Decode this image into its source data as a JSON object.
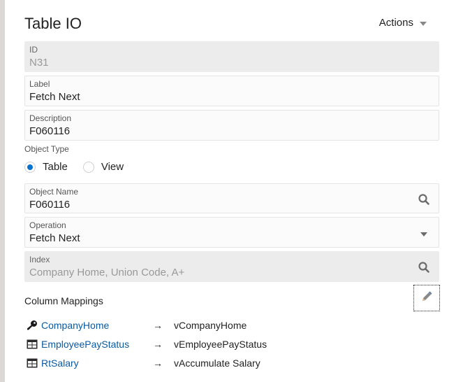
{
  "header": {
    "title": "Table IO",
    "actions_label": "Actions"
  },
  "fields": {
    "id": {
      "label": "ID",
      "value": "N31",
      "readonly": true
    },
    "label": {
      "label": "Label",
      "value": "Fetch Next"
    },
    "description": {
      "label": "Description",
      "value": "F060116"
    },
    "object_name": {
      "label": "Object Name",
      "value": "F060116",
      "icon": "search-icon"
    },
    "operation": {
      "label": "Operation",
      "value": "Fetch Next",
      "icon": "chevron-down-icon"
    },
    "index": {
      "label": "Index",
      "value": "Company Home, Union Code, A+",
      "icon": "search-icon",
      "readonly": true
    }
  },
  "object_type": {
    "label": "Object Type",
    "options": [
      {
        "label": "Table",
        "checked": true
      },
      {
        "label": "View",
        "checked": false
      }
    ]
  },
  "column_mappings": {
    "title": "Column Mappings",
    "edit_icon": "pencil-icon",
    "rows": [
      {
        "icon": "key-icon",
        "source": "CompanyHome",
        "arrow": "→",
        "target": "vCompanyHome"
      },
      {
        "icon": "grid-icon",
        "source": "EmployeePayStatus",
        "arrow": "→",
        "target": "vEmployeePayStatus"
      },
      {
        "icon": "grid-icon",
        "source": "RtSalary",
        "arrow": "→",
        "target": "vAccumulate Salary"
      }
    ]
  },
  "colors": {
    "accent": "#0572ce",
    "link": "#0a5aa0",
    "readonly_bg": "#ececec"
  }
}
